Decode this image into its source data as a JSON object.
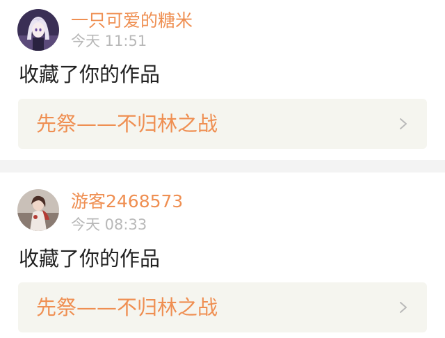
{
  "colors": {
    "accent": "#ef8f52",
    "time": "#b8b8b8",
    "text": "#222222",
    "card_bg": "#f5f5ef",
    "separator": "#f3f3f3"
  },
  "notifications": [
    {
      "avatar_icon": "anime-girl-avatar",
      "username": "一只可爱的糖米",
      "time": "今天 11:51",
      "message": "收藏了你的作品",
      "work_title": "先祭——不归林之战",
      "chevron_icon": "chevron-right-icon"
    },
    {
      "avatar_icon": "guest-avatar",
      "username": "游客2468573",
      "time": "今天 08:33",
      "message": "收藏了你的作品",
      "work_title": "先祭——不归林之战",
      "chevron_icon": "chevron-right-icon"
    }
  ]
}
